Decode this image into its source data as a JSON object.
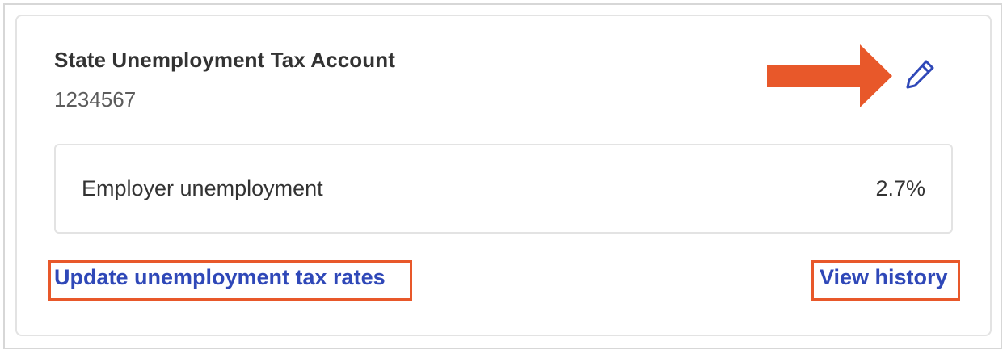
{
  "card": {
    "title": "State Unemployment Tax Account",
    "account_number": "1234567"
  },
  "rates": [
    {
      "label": "Employer unemployment",
      "value": "2.7%"
    }
  ],
  "links": {
    "update_rates": "Update unemployment tax rates",
    "view_history": "View history"
  },
  "icons": {
    "edit": "pencil-icon",
    "annotation": "right-arrow-icon"
  },
  "colors": {
    "link": "#2f48b8",
    "annotation": "#e8582a",
    "text": "#333333"
  }
}
